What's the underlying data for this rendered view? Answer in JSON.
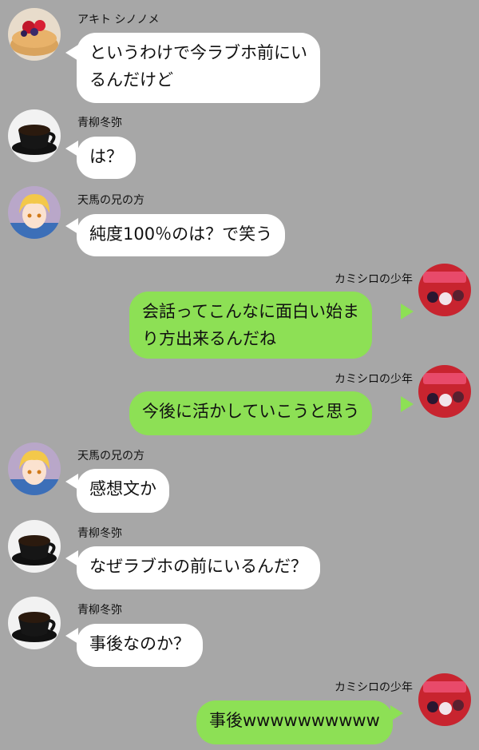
{
  "colors": {
    "background": "#a7a7a7",
    "incoming_bubble": "#ffffff",
    "outgoing_bubble": "#8de055"
  },
  "messages": [
    {
      "sender": "アキト シノノメ",
      "text_lines": [
        "というわけで今ラブホ前にい",
        "るんだけど"
      ],
      "side": "left",
      "avatar_icon": "pancake-avatar-icon"
    },
    {
      "sender": "青柳冬弥",
      "text_lines": [
        "は？"
      ],
      "side": "left",
      "avatar_icon": "coffee-cup-avatar-icon"
    },
    {
      "sender": "天馬の兄の方",
      "text_lines": [
        "純度100％のは？で笑う"
      ],
      "side": "left",
      "avatar_icon": "blond-boy-avatar-icon"
    },
    {
      "sender": "カミシロの少年",
      "text_lines": [
        "会話ってこんなに面白い始ま",
        "り方出来るんだね"
      ],
      "side": "right",
      "avatar_icon": "red-poster-avatar-icon"
    },
    {
      "sender": "カミシロの少年",
      "text_lines": [
        "今後に活かしていこうと思う"
      ],
      "side": "right",
      "avatar_icon": "red-poster-avatar-icon"
    },
    {
      "sender": "天馬の兄の方",
      "text_lines": [
        "感想文か"
      ],
      "side": "left",
      "avatar_icon": "blond-boy-avatar-icon"
    },
    {
      "sender": "青柳冬弥",
      "text_lines": [
        "なぜラブホの前にいるんだ？"
      ],
      "side": "left",
      "avatar_icon": "coffee-cup-avatar-icon"
    },
    {
      "sender": "青柳冬弥",
      "text_lines": [
        "事後なのか？"
      ],
      "side": "left",
      "avatar_icon": "coffee-cup-avatar-icon"
    },
    {
      "sender": "カミシロの少年",
      "text_lines": [
        "事後wwwwwwwwww"
      ],
      "side": "right",
      "avatar_icon": "red-poster-avatar-icon"
    }
  ]
}
